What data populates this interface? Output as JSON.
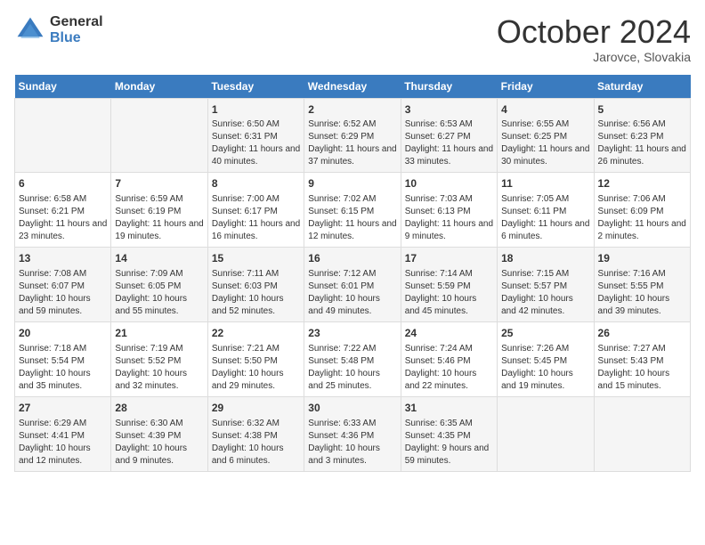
{
  "header": {
    "logo_line1": "General",
    "logo_line2": "Blue",
    "month_title": "October 2024",
    "location": "Jarovce, Slovakia"
  },
  "days_of_week": [
    "Sunday",
    "Monday",
    "Tuesday",
    "Wednesday",
    "Thursday",
    "Friday",
    "Saturday"
  ],
  "weeks": [
    [
      {
        "day": "",
        "content": ""
      },
      {
        "day": "",
        "content": ""
      },
      {
        "day": "1",
        "content": "Sunrise: 6:50 AM\nSunset: 6:31 PM\nDaylight: 11 hours and 40 minutes."
      },
      {
        "day": "2",
        "content": "Sunrise: 6:52 AM\nSunset: 6:29 PM\nDaylight: 11 hours and 37 minutes."
      },
      {
        "day": "3",
        "content": "Sunrise: 6:53 AM\nSunset: 6:27 PM\nDaylight: 11 hours and 33 minutes."
      },
      {
        "day": "4",
        "content": "Sunrise: 6:55 AM\nSunset: 6:25 PM\nDaylight: 11 hours and 30 minutes."
      },
      {
        "day": "5",
        "content": "Sunrise: 6:56 AM\nSunset: 6:23 PM\nDaylight: 11 hours and 26 minutes."
      }
    ],
    [
      {
        "day": "6",
        "content": "Sunrise: 6:58 AM\nSunset: 6:21 PM\nDaylight: 11 hours and 23 minutes."
      },
      {
        "day": "7",
        "content": "Sunrise: 6:59 AM\nSunset: 6:19 PM\nDaylight: 11 hours and 19 minutes."
      },
      {
        "day": "8",
        "content": "Sunrise: 7:00 AM\nSunset: 6:17 PM\nDaylight: 11 hours and 16 minutes."
      },
      {
        "day": "9",
        "content": "Sunrise: 7:02 AM\nSunset: 6:15 PM\nDaylight: 11 hours and 12 minutes."
      },
      {
        "day": "10",
        "content": "Sunrise: 7:03 AM\nSunset: 6:13 PM\nDaylight: 11 hours and 9 minutes."
      },
      {
        "day": "11",
        "content": "Sunrise: 7:05 AM\nSunset: 6:11 PM\nDaylight: 11 hours and 6 minutes."
      },
      {
        "day": "12",
        "content": "Sunrise: 7:06 AM\nSunset: 6:09 PM\nDaylight: 11 hours and 2 minutes."
      }
    ],
    [
      {
        "day": "13",
        "content": "Sunrise: 7:08 AM\nSunset: 6:07 PM\nDaylight: 10 hours and 59 minutes."
      },
      {
        "day": "14",
        "content": "Sunrise: 7:09 AM\nSunset: 6:05 PM\nDaylight: 10 hours and 55 minutes."
      },
      {
        "day": "15",
        "content": "Sunrise: 7:11 AM\nSunset: 6:03 PM\nDaylight: 10 hours and 52 minutes."
      },
      {
        "day": "16",
        "content": "Sunrise: 7:12 AM\nSunset: 6:01 PM\nDaylight: 10 hours and 49 minutes."
      },
      {
        "day": "17",
        "content": "Sunrise: 7:14 AM\nSunset: 5:59 PM\nDaylight: 10 hours and 45 minutes."
      },
      {
        "day": "18",
        "content": "Sunrise: 7:15 AM\nSunset: 5:57 PM\nDaylight: 10 hours and 42 minutes."
      },
      {
        "day": "19",
        "content": "Sunrise: 7:16 AM\nSunset: 5:55 PM\nDaylight: 10 hours and 39 minutes."
      }
    ],
    [
      {
        "day": "20",
        "content": "Sunrise: 7:18 AM\nSunset: 5:54 PM\nDaylight: 10 hours and 35 minutes."
      },
      {
        "day": "21",
        "content": "Sunrise: 7:19 AM\nSunset: 5:52 PM\nDaylight: 10 hours and 32 minutes."
      },
      {
        "day": "22",
        "content": "Sunrise: 7:21 AM\nSunset: 5:50 PM\nDaylight: 10 hours and 29 minutes."
      },
      {
        "day": "23",
        "content": "Sunrise: 7:22 AM\nSunset: 5:48 PM\nDaylight: 10 hours and 25 minutes."
      },
      {
        "day": "24",
        "content": "Sunrise: 7:24 AM\nSunset: 5:46 PM\nDaylight: 10 hours and 22 minutes."
      },
      {
        "day": "25",
        "content": "Sunrise: 7:26 AM\nSunset: 5:45 PM\nDaylight: 10 hours and 19 minutes."
      },
      {
        "day": "26",
        "content": "Sunrise: 7:27 AM\nSunset: 5:43 PM\nDaylight: 10 hours and 15 minutes."
      }
    ],
    [
      {
        "day": "27",
        "content": "Sunrise: 6:29 AM\nSunset: 4:41 PM\nDaylight: 10 hours and 12 minutes."
      },
      {
        "day": "28",
        "content": "Sunrise: 6:30 AM\nSunset: 4:39 PM\nDaylight: 10 hours and 9 minutes."
      },
      {
        "day": "29",
        "content": "Sunrise: 6:32 AM\nSunset: 4:38 PM\nDaylight: 10 hours and 6 minutes."
      },
      {
        "day": "30",
        "content": "Sunrise: 6:33 AM\nSunset: 4:36 PM\nDaylight: 10 hours and 3 minutes."
      },
      {
        "day": "31",
        "content": "Sunrise: 6:35 AM\nSunset: 4:35 PM\nDaylight: 9 hours and 59 minutes."
      },
      {
        "day": "",
        "content": ""
      },
      {
        "day": "",
        "content": ""
      }
    ]
  ]
}
